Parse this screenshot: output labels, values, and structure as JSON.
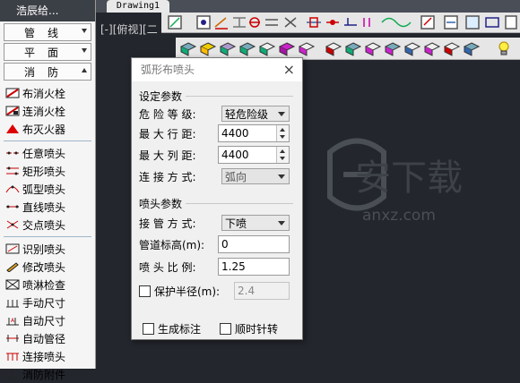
{
  "sidebar": {
    "title": "浩辰给...",
    "categories": [
      {
        "label": "管线",
        "arrow": "down"
      },
      {
        "label": "平面",
        "arrow": "down"
      },
      {
        "label": "消防",
        "arrow": "up"
      }
    ],
    "items_a": [
      "布消火栓",
      "连消火栓",
      "布灭火器"
    ],
    "items_b": [
      "任意喷头",
      "矩形喷头",
      "弧型喷头",
      "直线喷头",
      "交点喷头"
    ],
    "items_c": [
      "识别喷头",
      "修改喷头",
      "喷淋检查",
      "手动尺寸",
      "自动尺寸",
      "自动管径",
      "连接喷头",
      "消防附件"
    ]
  },
  "tab": {
    "label": "Drawing1"
  },
  "view_label": "[-][俯视][二",
  "dialog": {
    "title": "弧形布喷头",
    "close": "×",
    "group1_title": "设定参数",
    "hazard": {
      "label": "危 险 等 级:",
      "value": "轻危险级"
    },
    "max_row": {
      "label": "最 大 行 距:",
      "value": "4400"
    },
    "max_col": {
      "label": "最 大 列 距:",
      "value": "4400"
    },
    "connect": {
      "label": "连 接 方 式:",
      "value": "弧向"
    },
    "group2_title": "喷头参数",
    "pipe_conn": {
      "label": "接 管 方 式:",
      "value": "下喷"
    },
    "pipe_elev": {
      "label": "管道标高(m):",
      "value": "0"
    },
    "ratio": {
      "label": "喷 头 比 例:",
      "value": "1.25"
    },
    "protect": {
      "label": "保护半径(m):",
      "value": "2.4"
    },
    "gen_label": "生成标注",
    "clockwise": "顺时针转"
  },
  "watermark": {
    "text": "安下载",
    "sub": "anxz.com"
  }
}
